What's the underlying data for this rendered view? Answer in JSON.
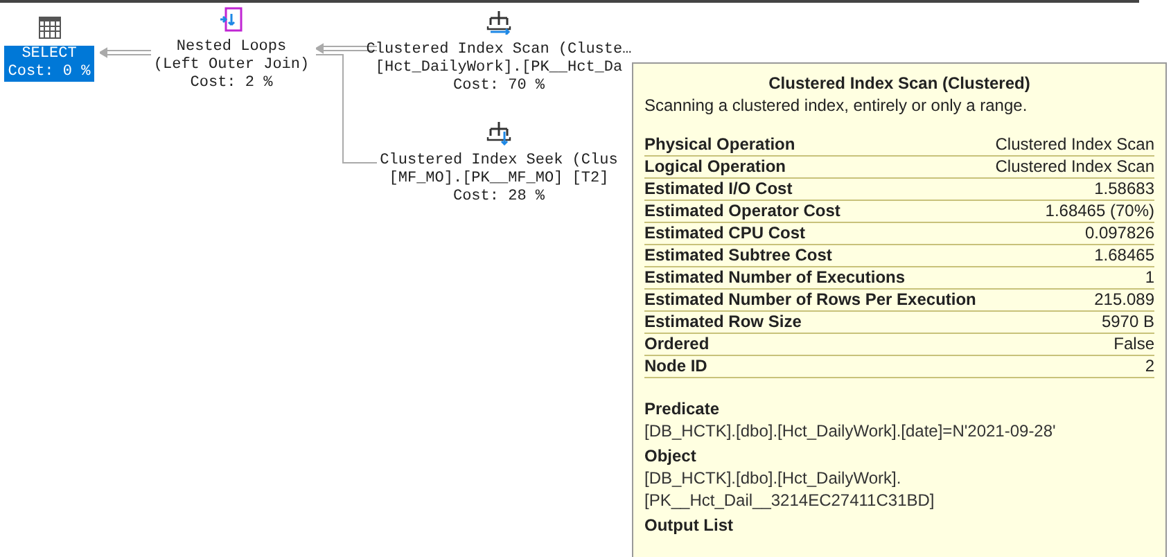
{
  "nodes": [
    {
      "kind": "select",
      "selected": true,
      "lines": [
        "SELECT",
        "Cost: 0 %"
      ]
    },
    {
      "kind": "loops",
      "selected": false,
      "lines": [
        "Nested Loops",
        "(Left Outer Join)",
        "Cost: 2 %"
      ]
    },
    {
      "kind": "scan",
      "selected": false,
      "lines": [
        "Clustered Index Scan (Cluste…",
        "[Hct_DailyWork].[PK__Hct_Da",
        "Cost: 70 %"
      ]
    },
    {
      "kind": "seek",
      "selected": false,
      "lines": [
        "Clustered Index Seek (Clus",
        "[MF_MO].[PK__MF_MO] [T2]",
        "Cost: 28 %"
      ]
    }
  ],
  "tooltip": {
    "title": "Clustered Index Scan (Clustered)",
    "description": "Scanning a clustered index, entirely or only a range.",
    "properties": [
      {
        "name": "Physical Operation",
        "value": "Clustered Index Scan"
      },
      {
        "name": "Logical Operation",
        "value": "Clustered Index Scan"
      },
      {
        "name": "Estimated I/O Cost",
        "value": "1.58683"
      },
      {
        "name": "Estimated Operator Cost",
        "value": "1.68465 (70%)"
      },
      {
        "name": "Estimated CPU Cost",
        "value": "0.097826"
      },
      {
        "name": "Estimated Subtree Cost",
        "value": "1.68465"
      },
      {
        "name": "Estimated Number of Executions",
        "value": "1"
      },
      {
        "name": "Estimated Number of Rows Per Execution",
        "value": "215.089"
      },
      {
        "name": "Estimated Row Size",
        "value": "5970 B"
      },
      {
        "name": "Ordered",
        "value": "False"
      },
      {
        "name": "Node ID",
        "value": "2"
      }
    ],
    "sections": [
      {
        "heading": "Predicate",
        "lines": [
          "[DB_HCTK].[dbo].[Hct_DailyWork].[date]=N'2021-09-28'"
        ]
      },
      {
        "heading": "Object",
        "lines": [
          "[DB_HCTK].[dbo].[Hct_DailyWork].",
          "[PK__Hct_Dail__3214EC27411C31BD]"
        ]
      },
      {
        "heading": "Output List"
      }
    ]
  }
}
